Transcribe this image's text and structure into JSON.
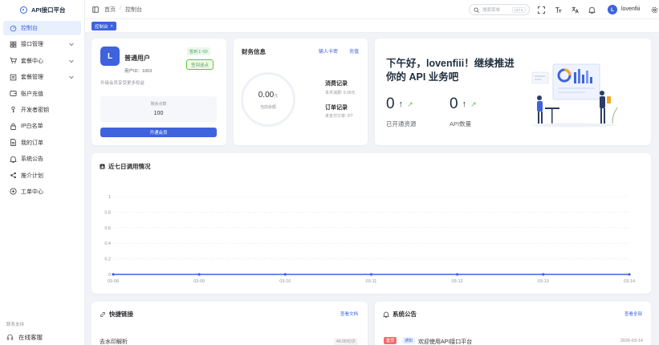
{
  "app": {
    "title": "API接口平台"
  },
  "sidebar": {
    "items": [
      {
        "label": "控制台",
        "icon": "dashboard-icon",
        "active": true,
        "expandable": false
      },
      {
        "label": "接口管理",
        "icon": "grid-icon",
        "active": false,
        "expandable": true
      },
      {
        "label": "套餐中心",
        "icon": "cart-icon",
        "active": false,
        "expandable": true
      },
      {
        "label": "套餐管理",
        "icon": "box-icon",
        "active": false,
        "expandable": true
      },
      {
        "label": "账户充值",
        "icon": "wallet-icon",
        "active": false,
        "expandable": false
      },
      {
        "label": "开发者密钥",
        "icon": "key-icon",
        "active": false,
        "expandable": false
      },
      {
        "label": "IP白名单",
        "icon": "lock-icon",
        "active": false,
        "expandable": false
      },
      {
        "label": "我的订单",
        "icon": "document-icon",
        "active": false,
        "expandable": false
      },
      {
        "label": "系统公告",
        "icon": "bell-icon",
        "active": false,
        "expandable": false
      },
      {
        "label": "推介计划",
        "icon": "share-icon",
        "active": false,
        "expandable": false
      },
      {
        "label": "工单中心",
        "icon": "ticket-icon",
        "active": false,
        "expandable": false
      }
    ],
    "contact_label": "联系支持",
    "contact_item": "在线客服"
  },
  "header": {
    "breadcrumb": [
      "首页",
      "控制台"
    ],
    "search_placeholder": "搜索菜单",
    "search_shortcut": "Ctrl K",
    "username": "lovenfiii",
    "avatar_letter": "L"
  },
  "tags": {
    "active": "控制台"
  },
  "user_card": {
    "avatar_letter": "L",
    "name": "普通用户",
    "user_id": "用户ID：1003",
    "upgrade_hint": "升级会员享受更多权益",
    "sign_badge": "签到 1~50",
    "sign_button": "签到送点",
    "points_label": "剩余点数",
    "points_value": "100",
    "vip_button": "开通会员"
  },
  "finance_card": {
    "title": "财务信息",
    "link_card": "输入卡密",
    "link_recharge": "充值",
    "balance": "0.00",
    "balance_unit": "元",
    "balance_label": "当前余额",
    "consume_title": "消费记录",
    "consume_sub": "本月消费: 0.00元",
    "order_title": "订单记录",
    "order_sub": "未支付订单: 0个"
  },
  "greeting_card": {
    "title": "下午好，lovenfiii！继续推进你的 API 业务吧",
    "stats": [
      {
        "value": "0",
        "label": "已开通资源"
      },
      {
        "value": "0",
        "label": "API数量"
      }
    ]
  },
  "chart_card": {
    "title": "近七日调用情况"
  },
  "chart_data": {
    "type": "line",
    "title": "近七日调用情况",
    "categories": [
      "03-08",
      "03-09",
      "03-10",
      "03-11",
      "03-12",
      "03-13",
      "03-14"
    ],
    "series": [
      {
        "values": [
          0,
          0,
          0,
          0,
          0,
          0,
          0
        ]
      }
    ],
    "y_ticks": [
      "0",
      "0.2",
      "0.4",
      "0.6",
      "0.8",
      "1"
    ],
    "ylim": [
      0,
      1
    ],
    "grid": true,
    "color": "#3e63dd"
  },
  "links_card": {
    "title": "快捷链接",
    "more": "查看文档",
    "item": "去水印解析",
    "item_badge": "49.00元/次"
  },
  "notice_card": {
    "title": "系统公告",
    "more": "查看全部",
    "top_badge": "置顶",
    "type_badge": "通知",
    "text": "欢迎使用API接口平台",
    "date": "2026-03-14"
  },
  "colors": {
    "primary": "#3e63dd",
    "success": "#67c23a",
    "danger": "#f56c6c"
  }
}
